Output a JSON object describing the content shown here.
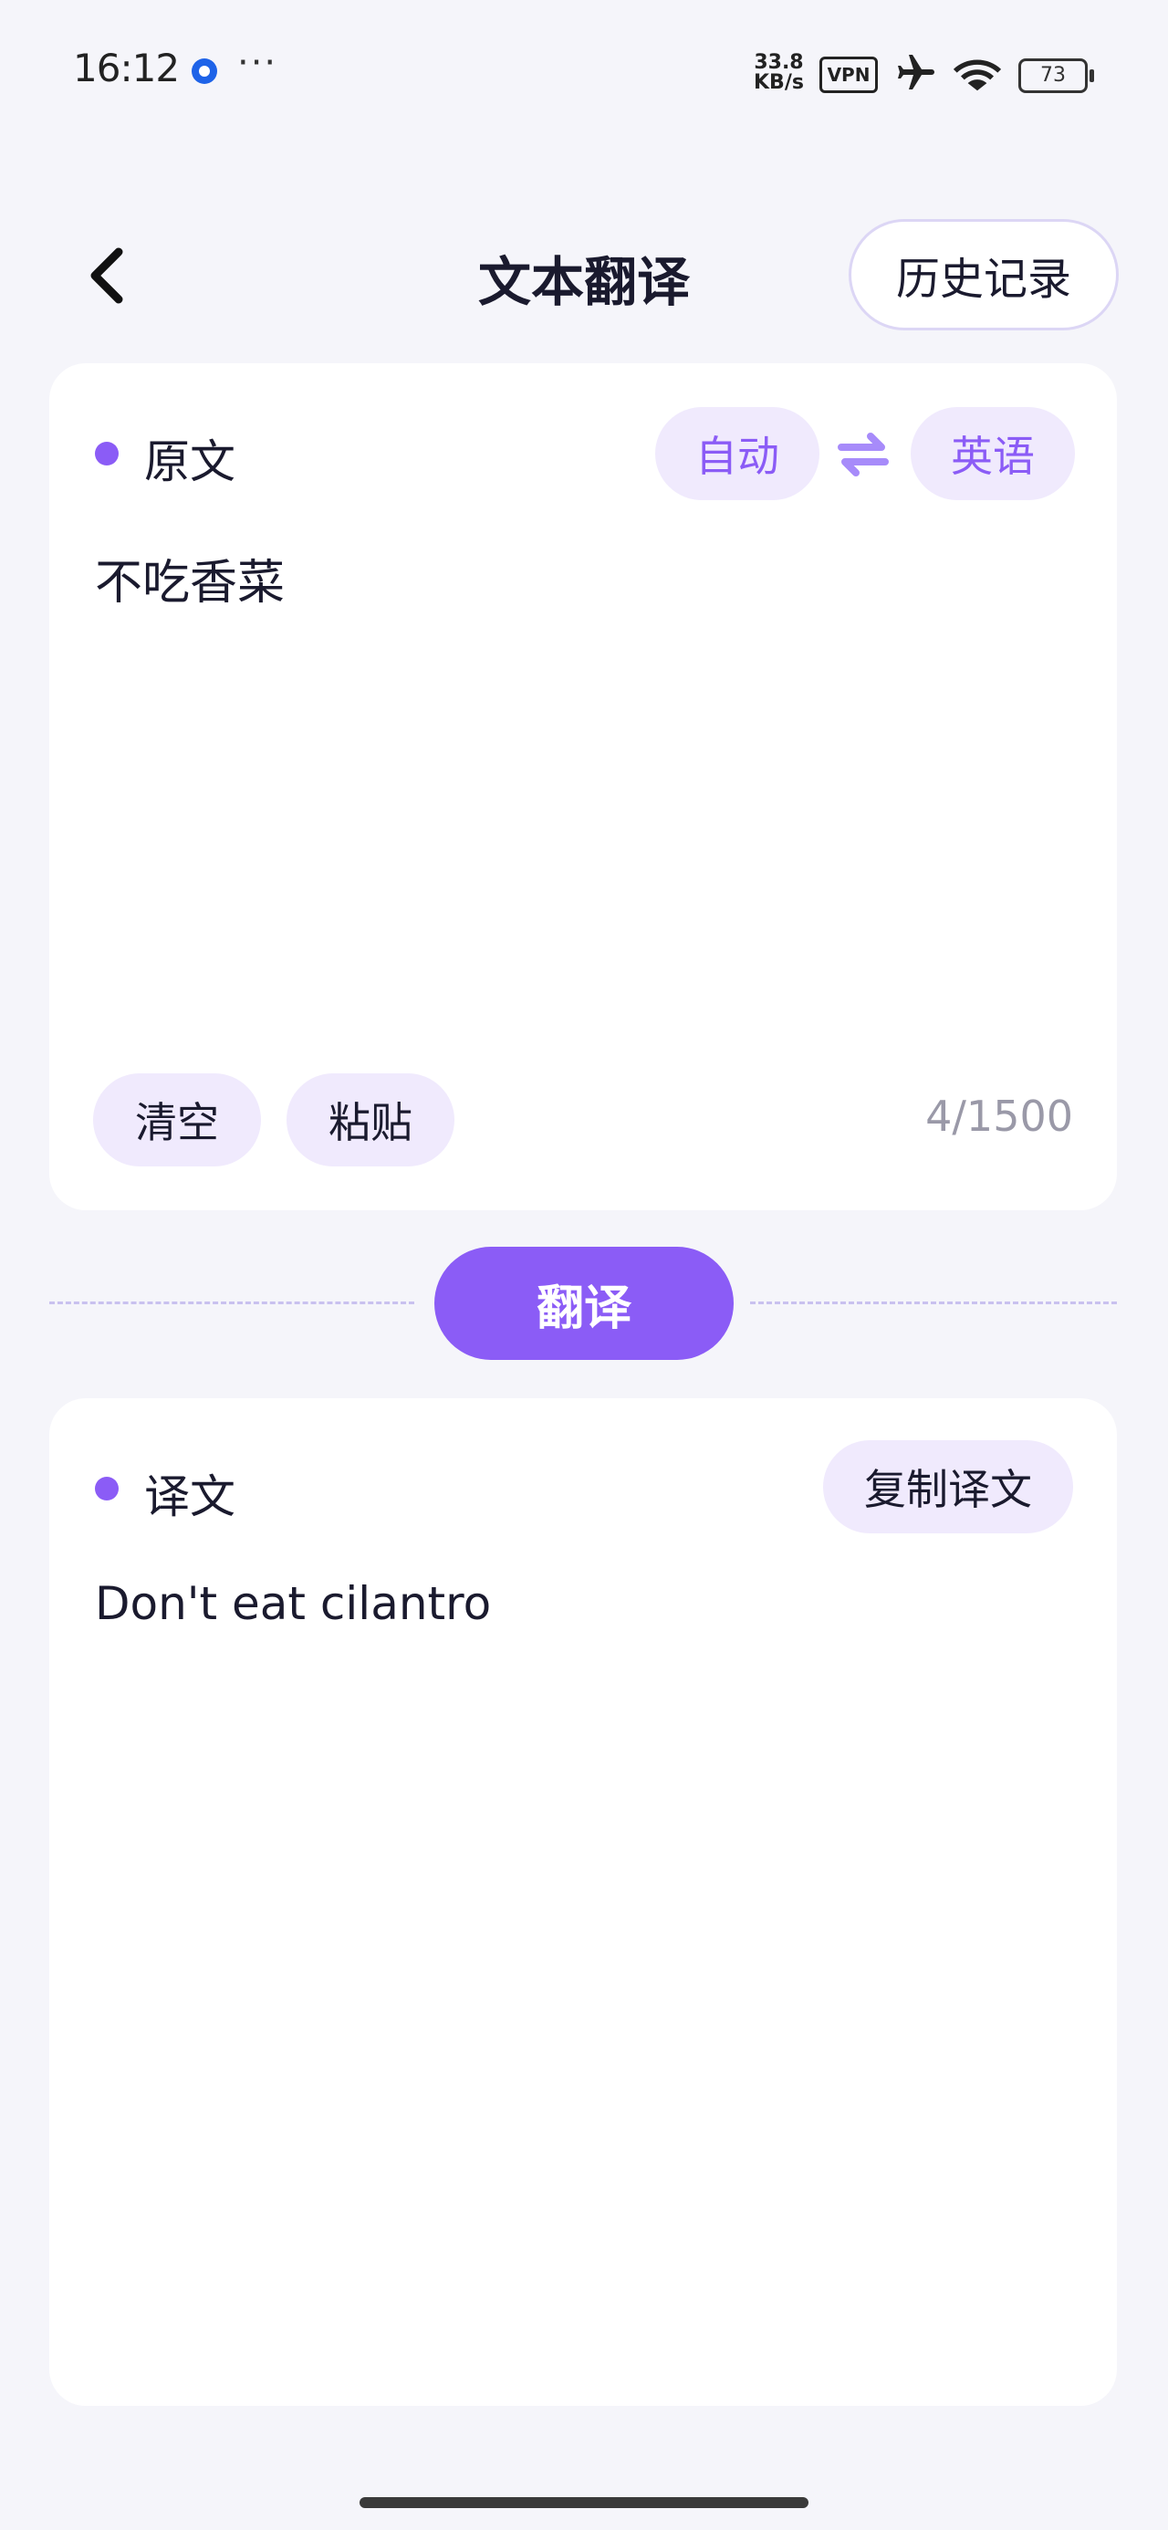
{
  "status_bar": {
    "time": "16:12",
    "more": "···",
    "net_speed_value": "33.8",
    "net_speed_unit": "KB/s",
    "vpn": "VPN",
    "battery": "73",
    "icons": [
      "app-notification-icon",
      "airplane-icon",
      "wifi-icon",
      "battery-icon"
    ]
  },
  "header": {
    "back_icon": "chevron-left-icon",
    "title": "文本翻译",
    "history_button": "历史记录"
  },
  "source": {
    "label": "原文",
    "source_lang": "自动",
    "swap_icon": "swap-arrows-icon",
    "target_lang": "英语",
    "text": "不吃香菜",
    "clear_button": "清空",
    "paste_button": "粘贴",
    "counter": "4/1500"
  },
  "translate_button": "翻译",
  "result": {
    "label": "译文",
    "copy_button": "复制译文",
    "text": "Don't eat cilantro"
  },
  "colors": {
    "accent": "#8b5cf6",
    "accent_light": "#f0eafd",
    "background": "#f5f5fa"
  }
}
